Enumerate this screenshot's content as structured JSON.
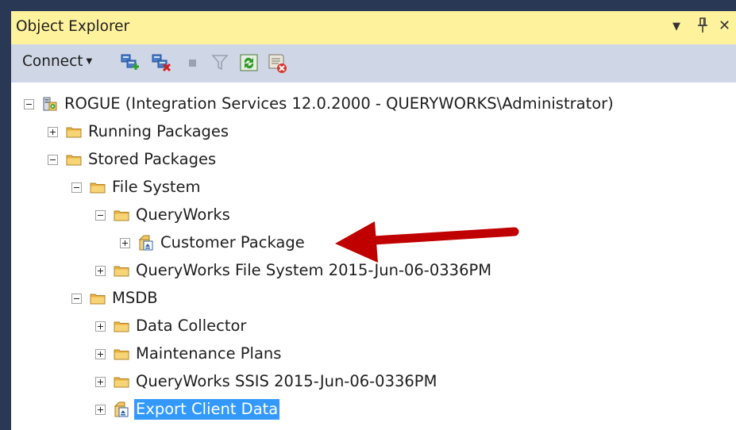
{
  "window": {
    "title": "Object Explorer",
    "controls": {
      "dropdown": "▼",
      "pin": "ᚦ",
      "close": "✕"
    }
  },
  "toolbar": {
    "connect_label": "Connect",
    "tools": [
      "connect-server-icon",
      "disconnect-server-icon",
      "stop-icon",
      "filter-icon",
      "refresh-icon",
      "summary-report-icon"
    ]
  },
  "tree": {
    "server": {
      "label": "ROGUE (Integration Services 12.0.2000 - QUERYWORKS\\Administrator)"
    },
    "running_packages": {
      "label": "Running Packages"
    },
    "stored_packages": {
      "label": "Stored Packages"
    },
    "file_system": {
      "label": "File System"
    },
    "queryworks": {
      "label": "QueryWorks"
    },
    "customer_package": {
      "label": "Customer Package"
    },
    "qw_file_system": {
      "label": "QueryWorks File System 2015-Jun-06-0336PM"
    },
    "msdb": {
      "label": "MSDB"
    },
    "data_collector": {
      "label": "Data Collector"
    },
    "maintenance_plans": {
      "label": "Maintenance Plans"
    },
    "qw_ssis": {
      "label": "QueryWorks SSIS 2015-Jun-06-0336PM"
    },
    "export_client_data": {
      "label": "Export Client Data",
      "selected": true
    }
  },
  "colors": {
    "titlebar": "#fff29d",
    "toolbar": "#cfd6e5",
    "frame": "#293955",
    "selection": "#3399ff",
    "folder": "#f4c960",
    "annotation_arrow": "#c00000"
  }
}
